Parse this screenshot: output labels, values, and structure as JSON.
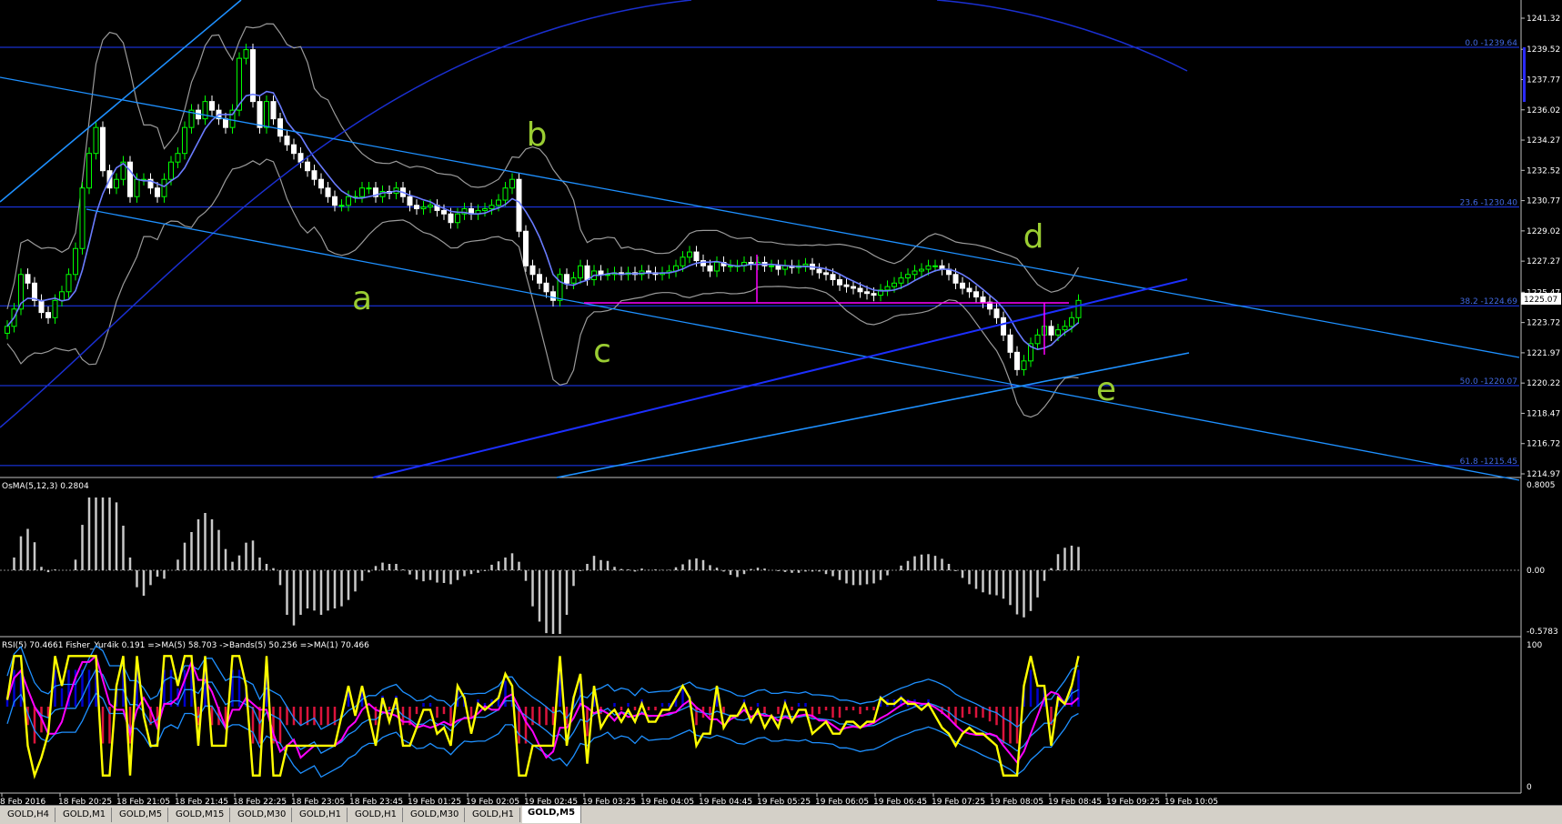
{
  "colors": {
    "background": "#000000",
    "bull": "#00ff00",
    "bear": "#ffffff",
    "channel": "#1e90ff",
    "ma": "#4169e1",
    "bands": "#9a9a9a",
    "fibo": "#1e3cff",
    "magenta": "#ff00ff",
    "wave_label": "#9acd32",
    "rsi": "#ffff00",
    "hist_up": "#0000cd",
    "hist_down": "#dc143c"
  },
  "main": {
    "price_axis": [
      "1241.32",
      "1239.52",
      "1237.77",
      "1236.02",
      "1234.27",
      "1232.52",
      "1230.77",
      "1229.02",
      "1227.27",
      "1225.47",
      "1223.72",
      "1221.97",
      "1220.22",
      "1218.47",
      "1216.72",
      "1214.97"
    ],
    "current_price": "1225.07",
    "fib_levels": [
      {
        "label": "0.0 -1239.64",
        "price": 1239.64
      },
      {
        "label": "23.6 -1230.40",
        "price": 1230.4
      },
      {
        "label": "38.2 -1224.69",
        "price": 1224.69
      },
      {
        "label": "50.0 -1220.07",
        "price": 1220.07
      },
      {
        "label": "61.8 -1215.45",
        "price": 1215.45
      }
    ],
    "wave_labels": [
      "a",
      "b",
      "c",
      "d",
      "e"
    ]
  },
  "osma": {
    "title": "OsMA(5,12,3) 0.2804",
    "axis": [
      "0.8005",
      "0.00",
      "-0.5783"
    ]
  },
  "rsi": {
    "title": "RSI(5) 70.4661  Fisher_Yur4ik 0.191  =>MA(5) 58.703  ->Bands(5) 50.256  =>MA(1) 70.466",
    "axis": [
      "100",
      "0"
    ]
  },
  "time_axis": [
    "8 Feb 2016",
    "18 Feb 20:25",
    "18 Feb 21:05",
    "18 Feb 21:45",
    "18 Feb 22:25",
    "18 Feb 23:05",
    "18 Feb 23:45",
    "19 Feb 01:25",
    "19 Feb 02:05",
    "19 Feb 02:45",
    "19 Feb 03:25",
    "19 Feb 04:05",
    "19 Feb 04:45",
    "19 Feb 05:25",
    "19 Feb 06:05",
    "19 Feb 06:45",
    "19 Feb 07:25",
    "19 Feb 08:05",
    "19 Feb 08:45",
    "19 Feb 09:25",
    "19 Feb 10:05"
  ],
  "tabs": [
    "GOLD,H4",
    "GOLD,M1",
    "GOLD,M5",
    "GOLD,M15",
    "GOLD,M30",
    "GOLD,H1",
    "GOLD,H1",
    "GOLD,M30",
    "GOLD,H1",
    "GOLD,M5"
  ],
  "chart_data": {
    "type": "candlestick",
    "symbol_timeframe": "GOLD,M5",
    "ylim": [
      1214.97,
      1241.32
    ],
    "close_path": [
      1223.5,
      1224.5,
      1226.5,
      1226.0,
      1225.0,
      1224.3,
      1224.0,
      1225.0,
      1225.5,
      1226.5,
      1228.0,
      1231.5,
      1233.5,
      1235.0,
      1232.5,
      1231.5,
      1232.0,
      1233.0,
      1231.0,
      1232.0,
      1232.0,
      1231.5,
      1231.0,
      1232.0,
      1233.0,
      1233.5,
      1235.0,
      1236.0,
      1235.5,
      1236.5,
      1236.0,
      1235.5,
      1235.0,
      1236.0,
      1239.0,
      1239.5,
      1236.5,
      1235.0,
      1236.5,
      1235.5,
      1234.5,
      1234.0,
      1233.5,
      1233.0,
      1232.5,
      1232.0,
      1231.5,
      1231.0,
      1230.5,
      1230.5,
      1231.0,
      1231.0,
      1231.5,
      1231.5,
      1231.0,
      1231.3,
      1231.2,
      1231.5,
      1231.0,
      1230.5,
      1230.3,
      1230.4,
      1230.5,
      1230.2,
      1230.0,
      1229.5,
      1230.0,
      1230.3,
      1230.0,
      1230.2,
      1230.3,
      1230.5,
      1230.8,
      1231.5,
      1232.0,
      1229.0,
      1227.0,
      1226.5,
      1226.0,
      1225.5,
      1225.0,
      1226.5,
      1226.0,
      1226.3,
      1227.0,
      1226.2,
      1226.7,
      1226.5,
      1226.5,
      1226.6,
      1226.5,
      1226.6,
      1226.5,
      1226.7,
      1226.6,
      1226.5,
      1226.6,
      1226.7,
      1227.0,
      1227.5,
      1227.8,
      1227.3,
      1227.0,
      1226.7,
      1227.2,
      1227.0,
      1227.0,
      1227.0,
      1227.2,
      1227.1,
      1227.2,
      1227.0,
      1227.0,
      1226.8,
      1227.0,
      1226.9,
      1227.0,
      1227.1,
      1226.8,
      1226.6,
      1226.5,
      1226.2,
      1225.9,
      1225.8,
      1225.7,
      1225.5,
      1225.4,
      1225.3,
      1225.6,
      1225.8,
      1226.0,
      1226.3,
      1226.5,
      1226.7,
      1226.8,
      1227.0,
      1227.0,
      1226.8,
      1226.5,
      1226.0,
      1225.7,
      1225.5,
      1225.2,
      1224.9,
      1224.5,
      1224.0,
      1223.0,
      1222.0,
      1221.0,
      1221.5,
      1222.5,
      1223.0,
      1223.5,
      1223.0,
      1223.3,
      1223.5,
      1224.0,
      1225.0
    ]
  }
}
